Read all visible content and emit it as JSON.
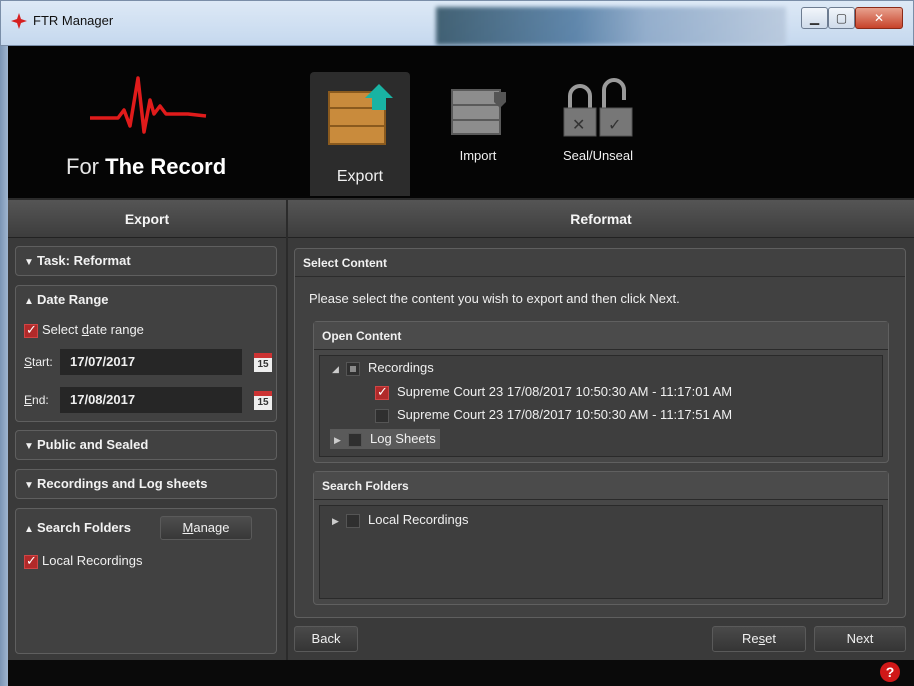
{
  "window": {
    "title": "FTR Manager",
    "min_glyph": "▁",
    "max_glyph": "▢",
    "close_glyph": "✕"
  },
  "logo": {
    "text_light": "For ",
    "text_bold": "The Record"
  },
  "toolbar": {
    "export": "Export",
    "import": "Import",
    "seal": "Seal/Unseal"
  },
  "left": {
    "header": "Export",
    "task": {
      "label": "Task: Reformat"
    },
    "date_range": {
      "label": "Date Range",
      "checkbox_pre": "Select ",
      "checkbox_u": "d",
      "checkbox_post": "ate range",
      "start_label_u": "S",
      "start_label_post": "tart:",
      "start_value": "17/07/2017",
      "end_label_u": "E",
      "end_label_post": "nd:",
      "end_value": "17/08/2017",
      "cal_day": "15"
    },
    "public_sealed": {
      "label": "Public and Sealed"
    },
    "rec_log": {
      "label": "Recordings and Log sheets"
    },
    "search_folders": {
      "label": "Search Folders",
      "manage_u": "M",
      "manage_post": "anage",
      "item": "Local Recordings"
    }
  },
  "right": {
    "header": "Reformat",
    "select_content": "Select Content",
    "instruction": "Please select the content you wish to export and then click Next.",
    "open_content": {
      "label": "Open Content",
      "recordings": "Recordings",
      "items": [
        "Supreme Court 23 17/08/2017 10:50:30 AM - 11:17:01 AM",
        "Supreme Court 23 17/08/2017 10:50:30 AM - 11:17:51 AM"
      ],
      "log_sheets": "Log Sheets"
    },
    "search_folders": {
      "label": "Search Folders",
      "item": "Local Recordings"
    }
  },
  "footer": {
    "back": "Back",
    "reset_pre": "Re",
    "reset_u": "s",
    "reset_post": "et",
    "next": "Next",
    "help": "?"
  },
  "colors": {
    "accent_red": "#d01818",
    "panel": "#3a3a3a"
  }
}
